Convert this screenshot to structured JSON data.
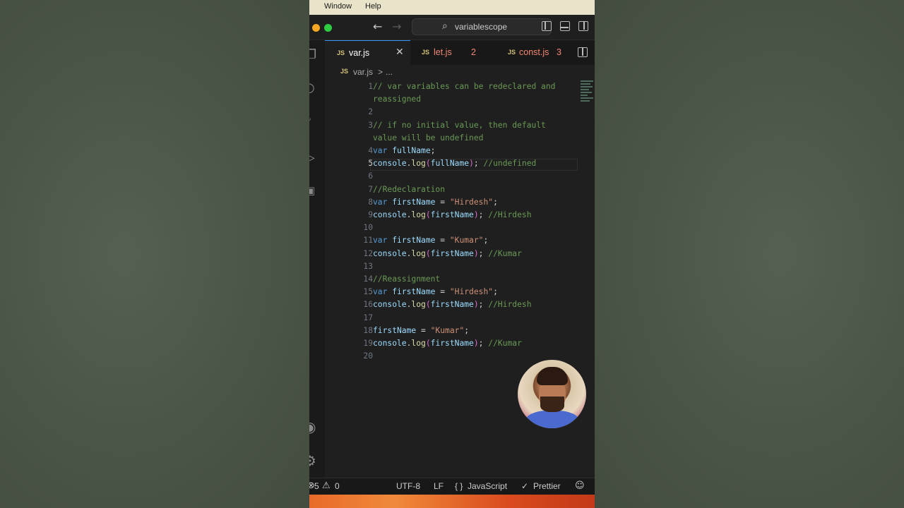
{
  "menubar": {
    "items": [
      "Window",
      "Help"
    ]
  },
  "titlebar": {
    "search_text": "variablescope"
  },
  "tabs": [
    {
      "name": "var.js",
      "badge": "",
      "active": true
    },
    {
      "name": "let.js",
      "badge": "2",
      "active": false
    },
    {
      "name": "const.js",
      "badge": "3",
      "active": false
    }
  ],
  "breadcrumb": {
    "file": "var.js",
    "sep": ">",
    "more": "..."
  },
  "editor": {
    "current_line": 5,
    "lines": [
      {
        "n": "1",
        "t": [
          [
            "// var variables can be redeclared and",
            "comment"
          ]
        ]
      },
      {
        "n": "",
        "t": [
          [
            "reassigned",
            "comment"
          ]
        ]
      },
      {
        "n": "2",
        "t": []
      },
      {
        "n": "3",
        "t": [
          [
            "// if no initial value, then default",
            "comment"
          ]
        ]
      },
      {
        "n": "",
        "t": [
          [
            "value will be undefined",
            "comment"
          ]
        ]
      },
      {
        "n": "4",
        "t": [
          [
            "var ",
            "kw"
          ],
          [
            "fullName",
            "var"
          ],
          [
            ";",
            "plain"
          ]
        ]
      },
      {
        "n": "5",
        "t": [
          [
            "console",
            "var"
          ],
          [
            ".",
            "plain"
          ],
          [
            "log",
            "fn"
          ],
          [
            "(",
            "paren"
          ],
          [
            "fullName",
            "var"
          ],
          [
            ")",
            "paren"
          ],
          [
            "; ",
            "plain"
          ],
          [
            "//undefined",
            "comment"
          ]
        ]
      },
      {
        "n": "6",
        "t": []
      },
      {
        "n": "7",
        "t": [
          [
            "//Redeclaration",
            "comment"
          ]
        ]
      },
      {
        "n": "8",
        "t": [
          [
            "var ",
            "kw"
          ],
          [
            "firstName",
            "var"
          ],
          [
            " = ",
            "plain"
          ],
          [
            "\"Hirdesh\"",
            "str"
          ],
          [
            ";",
            "plain"
          ]
        ]
      },
      {
        "n": "9",
        "t": [
          [
            "console",
            "var"
          ],
          [
            ".",
            "plain"
          ],
          [
            "log",
            "fn"
          ],
          [
            "(",
            "paren"
          ],
          [
            "firstName",
            "var"
          ],
          [
            ")",
            "paren"
          ],
          [
            "; ",
            "plain"
          ],
          [
            "//Hirdesh",
            "comment"
          ]
        ]
      },
      {
        "n": "10",
        "t": []
      },
      {
        "n": "11",
        "t": [
          [
            "var ",
            "kw"
          ],
          [
            "firstName",
            "var"
          ],
          [
            " = ",
            "plain"
          ],
          [
            "\"Kumar\"",
            "str"
          ],
          [
            ";",
            "plain"
          ]
        ]
      },
      {
        "n": "12",
        "t": [
          [
            "console",
            "var"
          ],
          [
            ".",
            "plain"
          ],
          [
            "log",
            "fn"
          ],
          [
            "(",
            "paren"
          ],
          [
            "firstName",
            "var"
          ],
          [
            ")",
            "paren"
          ],
          [
            "; ",
            "plain"
          ],
          [
            "//Kumar",
            "comment"
          ]
        ]
      },
      {
        "n": "13",
        "t": []
      },
      {
        "n": "14",
        "t": [
          [
            "//Reassignment",
            "comment"
          ]
        ]
      },
      {
        "n": "15",
        "t": [
          [
            "var ",
            "kw"
          ],
          [
            "firstName",
            "var"
          ],
          [
            " = ",
            "plain"
          ],
          [
            "\"Hirdesh\"",
            "str"
          ],
          [
            ";",
            "plain"
          ]
        ]
      },
      {
        "n": "16",
        "t": [
          [
            "console",
            "var"
          ],
          [
            ".",
            "plain"
          ],
          [
            "log",
            "fn"
          ],
          [
            "(",
            "paren"
          ],
          [
            "firstName",
            "var"
          ],
          [
            ")",
            "paren"
          ],
          [
            "; ",
            "plain"
          ],
          [
            "//Hirdesh",
            "comment"
          ]
        ]
      },
      {
        "n": "17",
        "t": []
      },
      {
        "n": "18",
        "t": [
          [
            "firstName",
            "var"
          ],
          [
            " = ",
            "plain"
          ],
          [
            "\"Kumar\"",
            "str"
          ],
          [
            ";",
            "plain"
          ]
        ]
      },
      {
        "n": "19",
        "t": [
          [
            "console",
            "var"
          ],
          [
            ".",
            "plain"
          ],
          [
            "log",
            "fn"
          ],
          [
            "(",
            "paren"
          ],
          [
            "firstName",
            "var"
          ],
          [
            ")",
            "paren"
          ],
          [
            "; ",
            "plain"
          ],
          [
            "//Kumar",
            "comment"
          ]
        ]
      },
      {
        "n": "20",
        "t": []
      }
    ]
  },
  "statusbar": {
    "errors": "5",
    "warnings": "0",
    "encoding": "UTF-8",
    "eol": "LF",
    "language": "JavaScript",
    "formatter": "Prettier"
  },
  "colors": {
    "accent": "#3794ff",
    "comment": "#6a9955",
    "keyword": "#569cd6",
    "string": "#ce9178",
    "error_tab": "#f48771"
  },
  "icons": [
    "back-arrow-icon",
    "forward-arrow-icon",
    "search-icon",
    "toggle-sidebar-icon",
    "toggle-panel-icon",
    "toggle-secondary-sidebar-icon",
    "split-editor-icon",
    "close-icon",
    "explorer-icon",
    "search-activity-icon",
    "source-control-icon",
    "run-debug-icon",
    "extensions-icon",
    "account-icon",
    "settings-gear-icon",
    "error-icon",
    "warning-icon",
    "braces-icon",
    "check-icon",
    "feedback-icon"
  ]
}
